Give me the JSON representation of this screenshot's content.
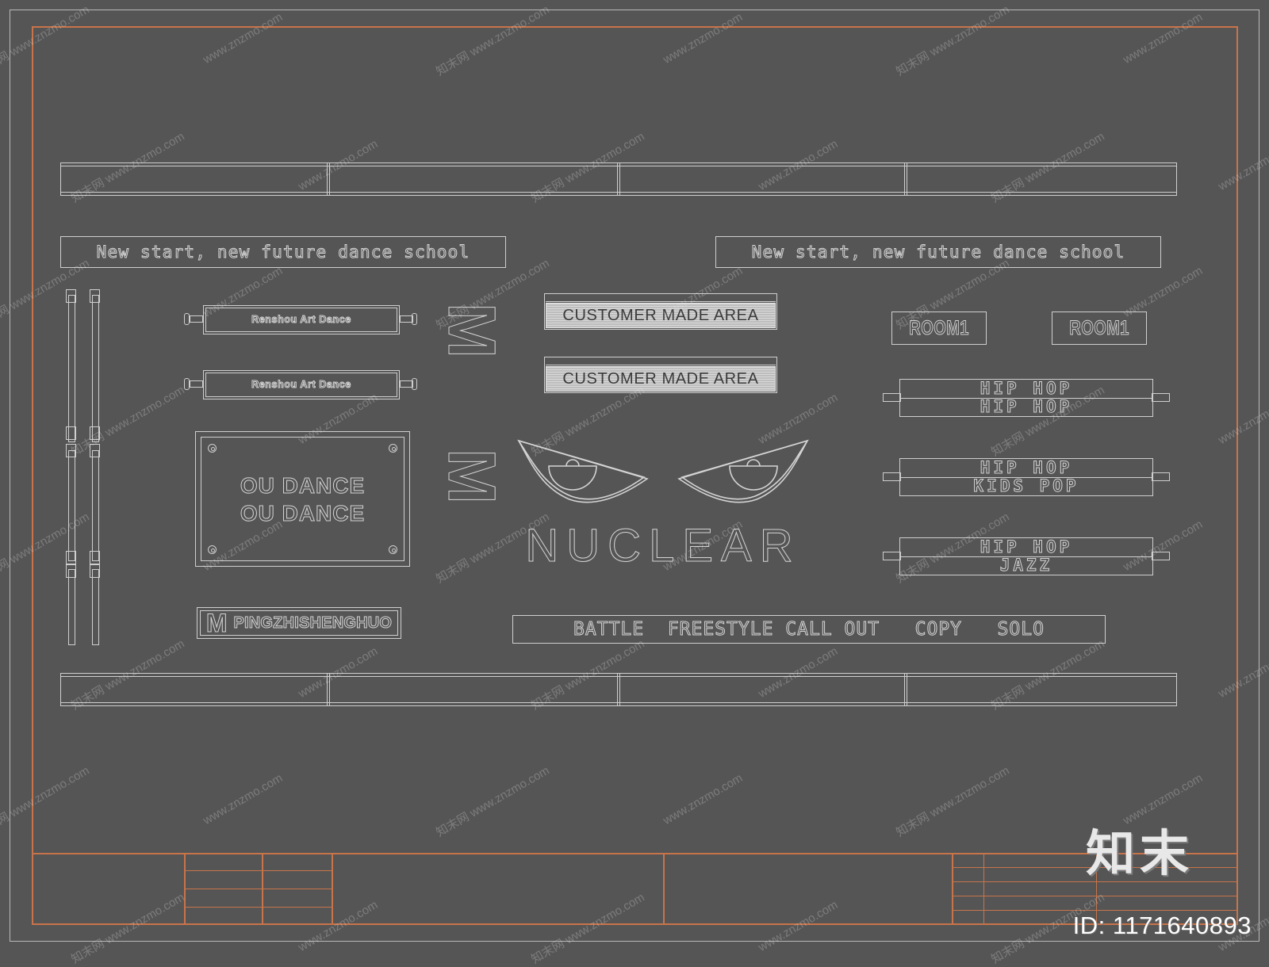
{
  "sheet": {
    "background_color": "#555555",
    "line_color": "#cfcfcf",
    "frame_color": "#c8744a"
  },
  "banners": {
    "slogan_left": "New start, new future dance school",
    "slogan_right": "New start, new future dance school"
  },
  "roller_signs": [
    {
      "label": "Renshou Art Dance"
    },
    {
      "label": "Renshou Art Dance"
    }
  ],
  "panel": {
    "line1": "OU DANCE",
    "line2": "OU DANCE"
  },
  "custom_area_bars": [
    {
      "label": "CUSTOMER MADE AREA"
    },
    {
      "label": "CUSTOMER MADE AREA"
    }
  ],
  "big_letters": [
    {
      "glyph": "M"
    },
    {
      "glyph": "M"
    }
  ],
  "brand_plate": {
    "mark": "M",
    "label": "PINGZHISHENGHUO"
  },
  "room_boxes": [
    {
      "label": "ROOM1"
    },
    {
      "label": "ROOM1"
    }
  ],
  "class_bars": [
    {
      "line1": "HIP HOP",
      "line2": "HIP HOP"
    },
    {
      "line1": "HIP HOP",
      "line2": "KIDS POP"
    },
    {
      "line1": "HIP HOP",
      "line2": "JAZZ"
    }
  ],
  "logo": {
    "wordmark": "NUCLEAR",
    "icon": "angry-eyes"
  },
  "battle_strip": {
    "label": "BATTLE  FREESTYLE CALL OUT   COPY   SOLO"
  },
  "watermark": {
    "brand": "知末",
    "id_label": "ID: 1171640893",
    "tile_text": "www.znzmo.com",
    "tile_logo": "知末网 www.znzmo.com"
  }
}
